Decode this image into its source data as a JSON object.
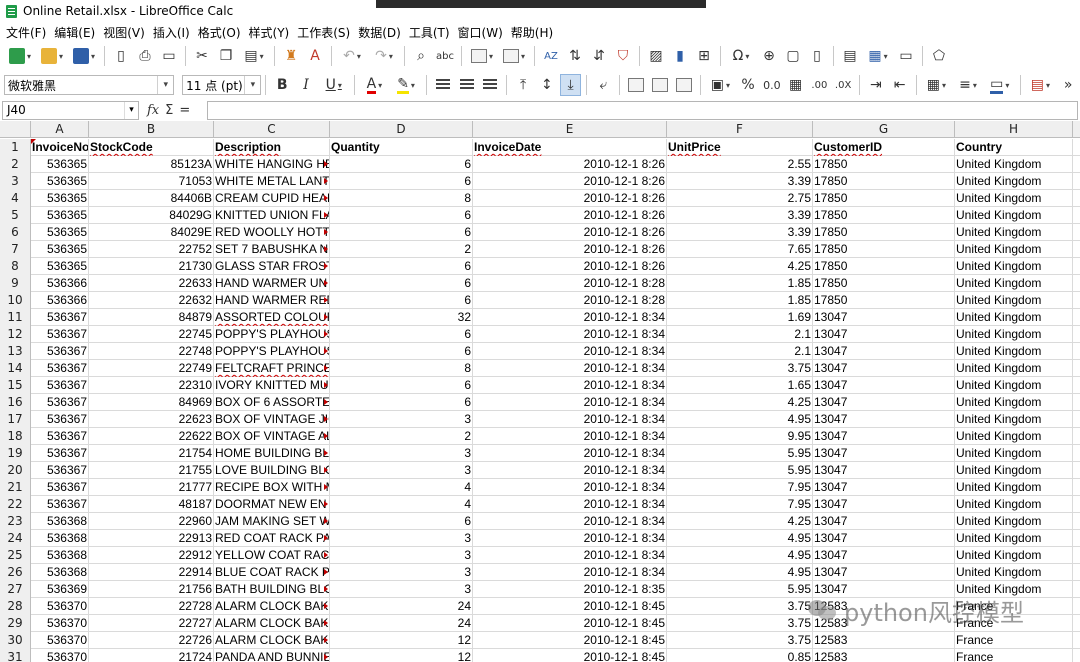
{
  "window": {
    "title": "Online Retail.xlsx - LibreOffice Calc"
  },
  "menu": [
    "文件(F)",
    "编辑(E)",
    "视图(V)",
    "插入(I)",
    "格式(O)",
    "样式(Y)",
    "工作表(S)",
    "数据(D)",
    "工具(T)",
    "窗口(W)",
    "帮助(H)"
  ],
  "format_bar": {
    "font_name": "微软雅黑",
    "font_size": "11 点 (pt)",
    "percent": "%",
    "decimal": "0.0",
    "add_decimal": ".00",
    "remove_decimal": ".0X"
  },
  "formula_bar": {
    "cell_ref": "J40",
    "fx": "fx",
    "sigma": "Σ",
    "equals": "=",
    "content": ""
  },
  "columns": [
    "A",
    "B",
    "C",
    "D",
    "E",
    "F",
    "G",
    "H"
  ],
  "rows": [
    {
      "n": "1",
      "a": "InvoiceNo",
      "b": "StockCode",
      "c": "Description",
      "d": "Quantity",
      "e": "InvoiceDate",
      "f": "UnitPrice",
      "g": "CustomerID",
      "h": "Country"
    },
    {
      "n": "2",
      "a": "536365",
      "b": "85123A",
      "c": "WHITE HANGING HE",
      "d": "6",
      "e": "2010-12-1 8:26",
      "f": "2.55",
      "g": "17850",
      "h": "United Kingdom"
    },
    {
      "n": "3",
      "a": "536365",
      "b": "71053",
      "c": "WHITE METAL LANT",
      "d": "6",
      "e": "2010-12-1 8:26",
      "f": "3.39",
      "g": "17850",
      "h": "United Kingdom"
    },
    {
      "n": "4",
      "a": "536365",
      "b": "84406B",
      "c": "CREAM CUPID HEAR",
      "d": "8",
      "e": "2010-12-1 8:26",
      "f": "2.75",
      "g": "17850",
      "h": "United Kingdom"
    },
    {
      "n": "5",
      "a": "536365",
      "b": "84029G",
      "c": "KNITTED UNION FLA",
      "d": "6",
      "e": "2010-12-1 8:26",
      "f": "3.39",
      "g": "17850",
      "h": "United Kingdom"
    },
    {
      "n": "6",
      "a": "536365",
      "b": "84029E",
      "c": "RED WOOLLY HOTTI",
      "d": "6",
      "e": "2010-12-1 8:26",
      "f": "3.39",
      "g": "17850",
      "h": "United Kingdom"
    },
    {
      "n": "7",
      "a": "536365",
      "b": "22752",
      "c": "SET 7 BABUSHKA NE",
      "d": "2",
      "e": "2010-12-1 8:26",
      "f": "7.65",
      "g": "17850",
      "h": "United Kingdom"
    },
    {
      "n": "8",
      "a": "536365",
      "b": "21730",
      "c": "GLASS STAR FROSTE",
      "d": "6",
      "e": "2010-12-1 8:26",
      "f": "4.25",
      "g": "17850",
      "h": "United Kingdom"
    },
    {
      "n": "9",
      "a": "536366",
      "b": "22633",
      "c": "HAND WARMER UN",
      "d": "6",
      "e": "2010-12-1 8:28",
      "f": "1.85",
      "g": "17850",
      "h": "United Kingdom"
    },
    {
      "n": "10",
      "a": "536366",
      "b": "22632",
      "c": "HAND WARMER RED",
      "d": "6",
      "e": "2010-12-1 8:28",
      "f": "1.85",
      "g": "17850",
      "h": "United Kingdom"
    },
    {
      "n": "11",
      "a": "536367",
      "b": "84879",
      "c": "ASSORTED COLOUR",
      "d": "32",
      "e": "2010-12-1 8:34",
      "f": "1.69",
      "g": "13047",
      "h": "United Kingdom"
    },
    {
      "n": "12",
      "a": "536367",
      "b": "22745",
      "c": "POPPY'S PLAYHOUSE",
      "d": "6",
      "e": "2010-12-1 8:34",
      "f": "2.1",
      "g": "13047",
      "h": "United Kingdom"
    },
    {
      "n": "13",
      "a": "536367",
      "b": "22748",
      "c": "POPPY'S PLAYHOUSE",
      "d": "6",
      "e": "2010-12-1 8:34",
      "f": "2.1",
      "g": "13047",
      "h": "United Kingdom"
    },
    {
      "n": "14",
      "a": "536367",
      "b": "22749",
      "c": "FELTCRAFT PRINCES",
      "d": "8",
      "e": "2010-12-1 8:34",
      "f": "3.75",
      "g": "13047",
      "h": "United Kingdom"
    },
    {
      "n": "15",
      "a": "536367",
      "b": "22310",
      "c": "IVORY KNITTED MU",
      "d": "6",
      "e": "2010-12-1 8:34",
      "f": "1.65",
      "g": "13047",
      "h": "United Kingdom"
    },
    {
      "n": "16",
      "a": "536367",
      "b": "84969",
      "c": "BOX OF 6 ASSORTED",
      "d": "6",
      "e": "2010-12-1 8:34",
      "f": "4.25",
      "g": "13047",
      "h": "United Kingdom"
    },
    {
      "n": "17",
      "a": "536367",
      "b": "22623",
      "c": "BOX OF VINTAGE JIG",
      "d": "3",
      "e": "2010-12-1 8:34",
      "f": "4.95",
      "g": "13047",
      "h": "United Kingdom"
    },
    {
      "n": "18",
      "a": "536367",
      "b": "22622",
      "c": "BOX OF VINTAGE AL",
      "d": "2",
      "e": "2010-12-1 8:34",
      "f": "9.95",
      "g": "13047",
      "h": "United Kingdom"
    },
    {
      "n": "19",
      "a": "536367",
      "b": "21754",
      "c": "HOME BUILDING BL",
      "d": "3",
      "e": "2010-12-1 8:34",
      "f": "5.95",
      "g": "13047",
      "h": "United Kingdom"
    },
    {
      "n": "20",
      "a": "536367",
      "b": "21755",
      "c": "LOVE BUILDING BLO",
      "d": "3",
      "e": "2010-12-1 8:34",
      "f": "5.95",
      "g": "13047",
      "h": "United Kingdom"
    },
    {
      "n": "21",
      "a": "536367",
      "b": "21777",
      "c": "RECIPE BOX WITH M",
      "d": "4",
      "e": "2010-12-1 8:34",
      "f": "7.95",
      "g": "13047",
      "h": "United Kingdom"
    },
    {
      "n": "22",
      "a": "536367",
      "b": "48187",
      "c": "DOORMAT NEW EN",
      "d": "4",
      "e": "2010-12-1 8:34",
      "f": "7.95",
      "g": "13047",
      "h": "United Kingdom"
    },
    {
      "n": "23",
      "a": "536368",
      "b": "22960",
      "c": "JAM MAKING SET W",
      "d": "6",
      "e": "2010-12-1 8:34",
      "f": "4.25",
      "g": "13047",
      "h": "United Kingdom"
    },
    {
      "n": "24",
      "a": "536368",
      "b": "22913",
      "c": "RED COAT RACK PAR",
      "d": "3",
      "e": "2010-12-1 8:34",
      "f": "4.95",
      "g": "13047",
      "h": "United Kingdom"
    },
    {
      "n": "25",
      "a": "536368",
      "b": "22912",
      "c": "YELLOW COAT RACK",
      "d": "3",
      "e": "2010-12-1 8:34",
      "f": "4.95",
      "g": "13047",
      "h": "United Kingdom"
    },
    {
      "n": "26",
      "a": "536368",
      "b": "22914",
      "c": "BLUE COAT RACK PA",
      "d": "3",
      "e": "2010-12-1 8:34",
      "f": "4.95",
      "g": "13047",
      "h": "United Kingdom"
    },
    {
      "n": "27",
      "a": "536369",
      "b": "21756",
      "c": "BATH BUILDING BLO",
      "d": "3",
      "e": "2010-12-1 8:35",
      "f": "5.95",
      "g": "13047",
      "h": "United Kingdom"
    },
    {
      "n": "28",
      "a": "536370",
      "b": "22728",
      "c": "ALARM CLOCK BAKE",
      "d": "24",
      "e": "2010-12-1 8:45",
      "f": "3.75",
      "g": "12583",
      "h": "France"
    },
    {
      "n": "29",
      "a": "536370",
      "b": "22727",
      "c": "ALARM CLOCK BAKE",
      "d": "24",
      "e": "2010-12-1 8:45",
      "f": "3.75",
      "g": "12583",
      "h": "France"
    },
    {
      "n": "30",
      "a": "536370",
      "b": "22726",
      "c": "ALARM CLOCK BAKE",
      "d": "12",
      "e": "2010-12-1 8:45",
      "f": "3.75",
      "g": "12583",
      "h": "France"
    },
    {
      "n": "31",
      "a": "536370",
      "b": "21724",
      "c": "PANDA AND BUNNIE",
      "d": "12",
      "e": "2010-12-1 8:45",
      "f": "0.85",
      "g": "12583",
      "h": "France"
    }
  ],
  "watermark": {
    "text": "python风控模型"
  },
  "colors": {
    "accent": "#1f9b48",
    "error_mark": "#c00000",
    "header_bg": "#efefef"
  }
}
